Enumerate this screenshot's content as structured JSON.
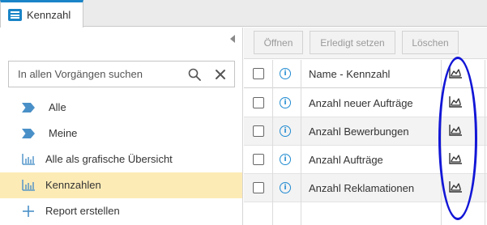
{
  "tab": {
    "label": "Kennzahl",
    "icon": "list-icon"
  },
  "sidebar": {
    "search": {
      "placeholder": "In allen Vorgängen suchen",
      "value": ""
    },
    "items": [
      {
        "label": "Alle",
        "icon": "chevron-tag-icon"
      },
      {
        "label": "Meine",
        "icon": "chevron-tag-icon"
      },
      {
        "label": "Alle als grafische Übersicht",
        "icon": "bar-chart-icon"
      },
      {
        "label": "Kennzahlen",
        "icon": "bar-chart-icon",
        "selected": true
      },
      {
        "label": "Report erstellen",
        "icon": "plus-icon"
      }
    ]
  },
  "toolbar": {
    "open_label": "Öffnen",
    "done_label": "Erledigt setzen",
    "delete_label": "Löschen"
  },
  "table": {
    "header": {
      "info": "i",
      "name": "Name - Kennzahl"
    },
    "rows": [
      {
        "name": "Anzahl neuer Aufträge"
      },
      {
        "name": "Anzahl Bewerbungen"
      },
      {
        "name": "Anzahl Aufträge"
      },
      {
        "name": "Anzahl Reklamationen"
      }
    ]
  },
  "colors": {
    "accent": "#1a84c7",
    "selection": "#fdebb6",
    "annotation": "#1216d6"
  }
}
